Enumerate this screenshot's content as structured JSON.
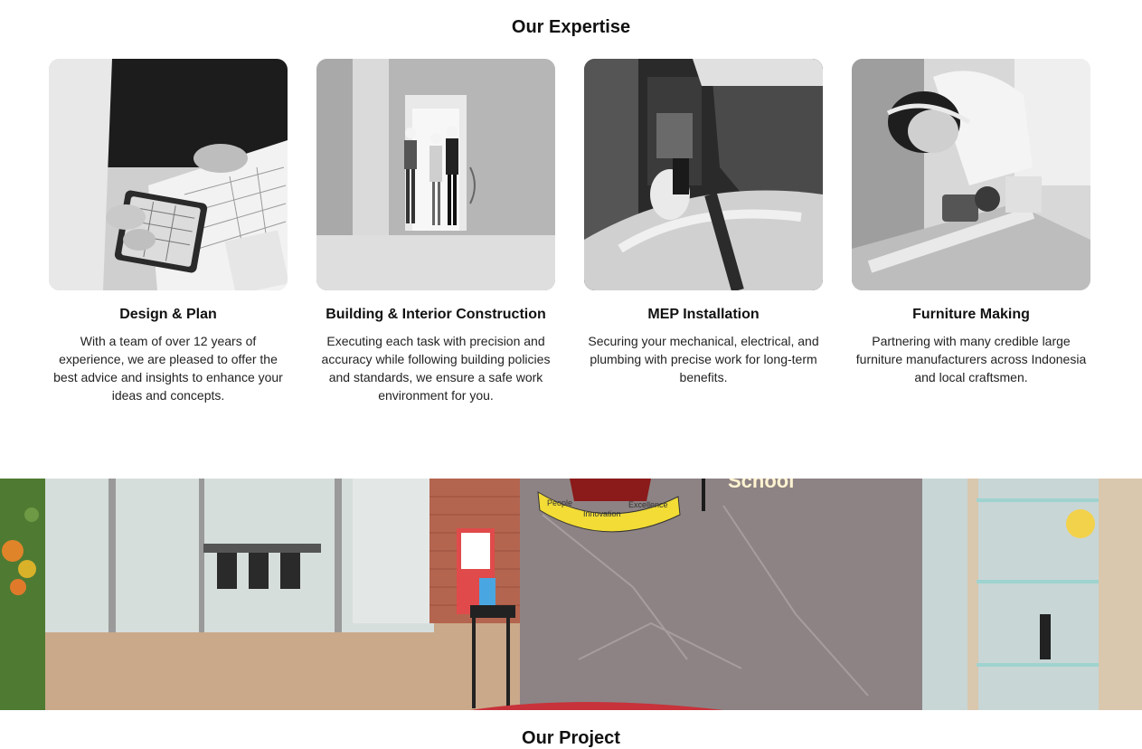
{
  "expertise": {
    "title": "Our Expertise",
    "cards": [
      {
        "title": "Design & Plan",
        "text": "With a team of over 12 years of experience, we are pleased to offer the best advice and insights to enhance your ideas and concepts."
      },
      {
        "title": "Building & Interior Construction",
        "text": "Executing each task with precision and accuracy while following building policies and standards, we ensure a safe work environment for you."
      },
      {
        "title": "MEP Installation",
        "text": "Securing your mechanical, electrical, and plumbing with precise work for long-term benefits."
      },
      {
        "title": "Furniture Making",
        "text": "Partnering with many credible large furniture manufacturers across Indonesia and local craftsmen."
      }
    ]
  },
  "banner": {
    "ribbon_words": [
      "People",
      "Innovation",
      "Excellence"
    ],
    "sign_text": "School"
  },
  "project": {
    "title": "Our Project"
  }
}
